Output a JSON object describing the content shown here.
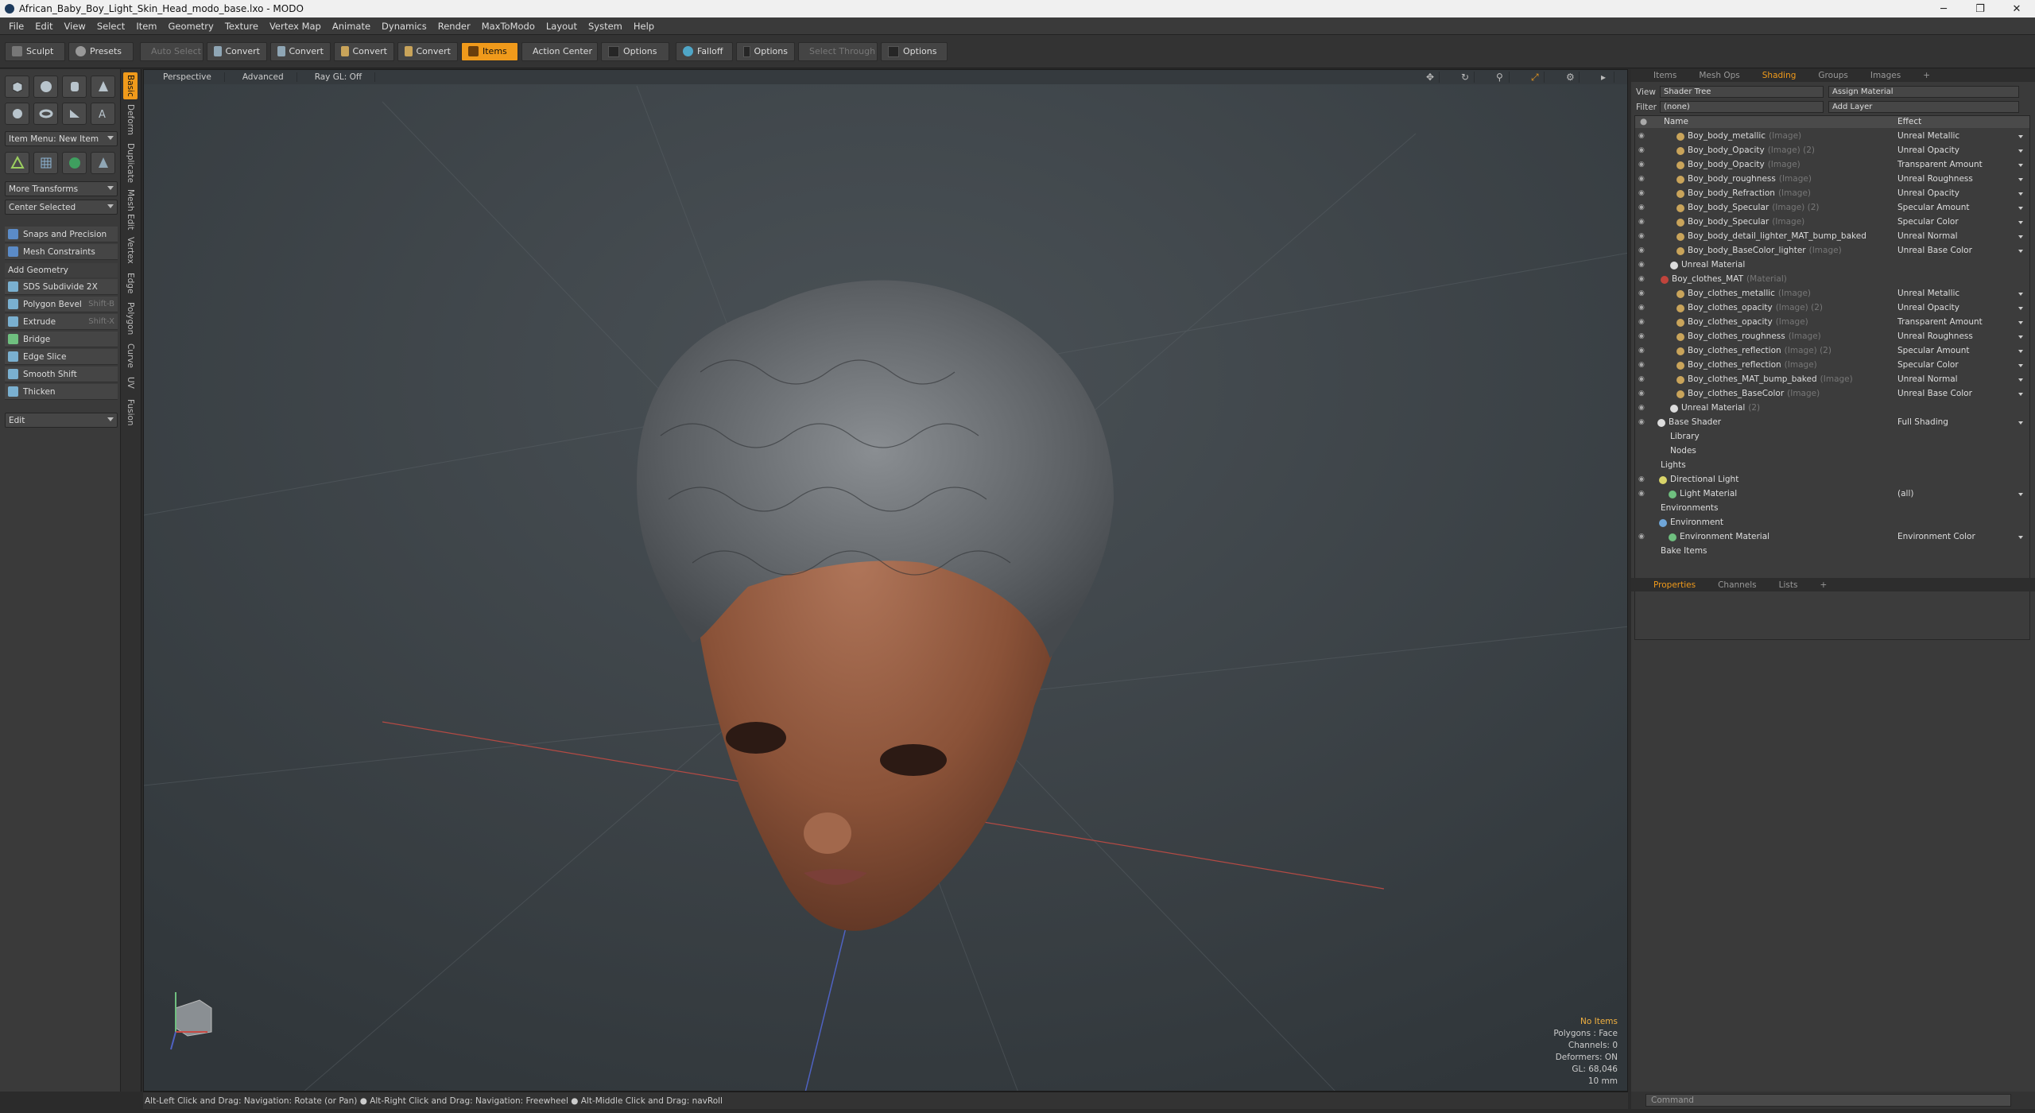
{
  "window": {
    "title": "African_Baby_Boy_Light_Skin_Head_modo_base.lxo - MODO",
    "minimize": "─",
    "maximize": "❐",
    "close": "✕"
  },
  "menu": [
    "File",
    "Edit",
    "View",
    "Select",
    "Item",
    "Geometry",
    "Texture",
    "Vertex Map",
    "Animate",
    "Dynamics",
    "Render",
    "MaxToModo",
    "Layout",
    "System",
    "Help"
  ],
  "toolbar": {
    "sculpt": "Sculpt",
    "presets": "Presets",
    "auto_select": "Auto Select",
    "convert": "Convert",
    "items": "Items",
    "action_center": "Action Center",
    "options": "Options",
    "falloff": "Falloff",
    "select_through": "Select Through"
  },
  "left": {
    "vtabs": [
      "Basic",
      "Deform",
      "Duplicate",
      "Mesh Edit",
      "Vertex",
      "Edge",
      "Polygon",
      "Curve",
      "UV",
      "Fusion"
    ],
    "item_menu": "Item Menu: New Item",
    "more_transforms": "More Transforms",
    "center_selected": "Center Selected",
    "snaps": "Snaps and Precision",
    "mesh_constraints": "Mesh Constraints",
    "add_geometry": "Add Geometry",
    "tools": [
      {
        "label": "SDS Subdivide 2X",
        "key": ""
      },
      {
        "label": "Polygon Bevel",
        "key": "Shift-B"
      },
      {
        "label": "Extrude",
        "key": "Shift-X"
      },
      {
        "label": "Bridge",
        "key": ""
      },
      {
        "label": "Edge Slice",
        "key": ""
      },
      {
        "label": "Smooth Shift",
        "key": ""
      },
      {
        "label": "Thicken",
        "key": ""
      }
    ],
    "edit": "Edit"
  },
  "viewport": {
    "tabs": [
      "Perspective",
      "Advanced",
      "Ray GL: Off"
    ],
    "info": {
      "items": "No Items",
      "polygons": "Polygons : Face",
      "channels": "Channels: 0",
      "deformers": "Deformers: ON",
      "gl": "GL: 68,046",
      "scale": "10 mm"
    }
  },
  "status": "Alt-Left Click and Drag: Navigation: Rotate (or Pan) ● Alt-Right Click and Drag: Navigation: Freewheel ● Alt-Middle Click and Drag: navRoll",
  "right": {
    "tabs": [
      "Items",
      "Mesh Ops",
      "Shading",
      "Groups",
      "Images",
      "+"
    ],
    "view_label": "View",
    "view_value": "Shader Tree",
    "assign": "Assign Material",
    "filter_label": "Filter",
    "filter_value": "(none)",
    "add_layer": "Add Layer",
    "col_name": "Name",
    "col_effect": "Effect",
    "rows": [
      {
        "name": "Boy_body_metallic",
        "tag": "(Image)",
        "effect": "Unreal Metallic"
      },
      {
        "name": "Boy_body_Opacity",
        "tag": "(Image) (2)",
        "effect": "Unreal Opacity"
      },
      {
        "name": "Boy_body_Opacity",
        "tag": "(Image)",
        "effect": "Transparent Amount"
      },
      {
        "name": "Boy_body_roughness",
        "tag": "(Image)",
        "effect": "Unreal Roughness"
      },
      {
        "name": "Boy_body_Refraction",
        "tag": "(Image)",
        "effect": "Unreal Opacity"
      },
      {
        "name": "Boy_body_Specular",
        "tag": "(Image) (2)",
        "effect": "Specular Amount"
      },
      {
        "name": "Boy_body_Specular",
        "tag": "(Image)",
        "effect": "Specular Color"
      },
      {
        "name": "Boy_body_detail_lighter_MAT_bump_baked",
        "tag": "",
        "effect": "Unreal Normal"
      },
      {
        "name": "Boy_body_BaseColor_lighter",
        "tag": "(Image)",
        "effect": "Unreal Base Color"
      },
      {
        "name": "Unreal Material",
        "tag": "",
        "effect": ""
      },
      {
        "name": "Boy_clothes_MAT",
        "tag": "(Material)",
        "effect": ""
      },
      {
        "name": "Boy_clothes_metallic",
        "tag": "(Image)",
        "effect": "Unreal Metallic"
      },
      {
        "name": "Boy_clothes_opacity",
        "tag": "(Image) (2)",
        "effect": "Unreal Opacity"
      },
      {
        "name": "Boy_clothes_opacity",
        "tag": "(Image)",
        "effect": "Transparent Amount"
      },
      {
        "name": "Boy_clothes_roughness",
        "tag": "(Image)",
        "effect": "Unreal Roughness"
      },
      {
        "name": "Boy_clothes_reflection",
        "tag": "(Image) (2)",
        "effect": "Specular Amount"
      },
      {
        "name": "Boy_clothes_reflection",
        "tag": "(Image)",
        "effect": "Specular Color"
      },
      {
        "name": "Boy_clothes_MAT_bump_baked",
        "tag": "(Image)",
        "effect": "Unreal Normal"
      },
      {
        "name": "Boy_clothes_BaseColor",
        "tag": "(Image)",
        "effect": "Unreal Base Color"
      },
      {
        "name": "Unreal Material",
        "tag": "(2)",
        "effect": ""
      },
      {
        "name": "Base Shader",
        "tag": "",
        "effect": "Full Shading"
      },
      {
        "name": "Library",
        "tag": "",
        "effect": ""
      },
      {
        "name": "Nodes",
        "tag": "",
        "effect": ""
      },
      {
        "name": "Lights",
        "tag": "",
        "effect": ""
      },
      {
        "name": "Directional Light",
        "tag": "",
        "effect": ""
      },
      {
        "name": "Light Material",
        "tag": "",
        "effect": "(all)"
      },
      {
        "name": "Environments",
        "tag": "",
        "effect": ""
      },
      {
        "name": "Environment",
        "tag": "",
        "effect": ""
      },
      {
        "name": "Environment Material",
        "tag": "",
        "effect": "Environment Color"
      },
      {
        "name": "Bake Items",
        "tag": "",
        "effect": ""
      }
    ],
    "prop_tabs": [
      "Properties",
      "Channels",
      "Lists",
      "+"
    ],
    "command": "Command"
  },
  "colors": {
    "accent": "#f09a1b",
    "viewport_bg": "#3d4347"
  }
}
